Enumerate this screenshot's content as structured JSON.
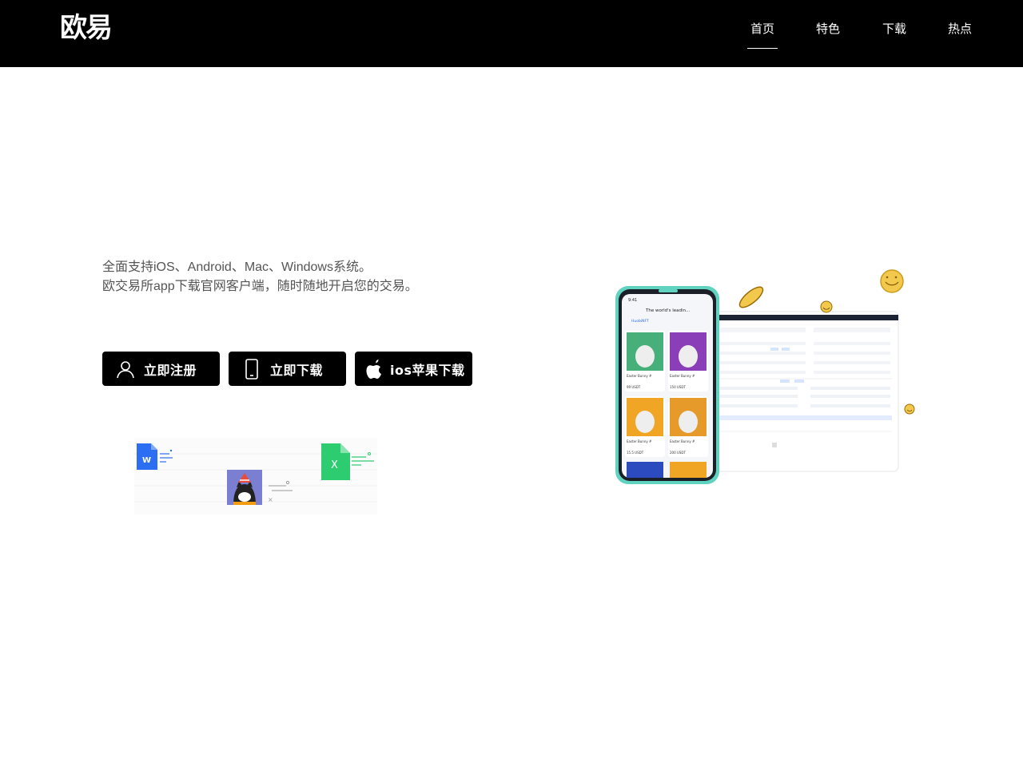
{
  "header": {
    "logo": "欧易",
    "nav": [
      {
        "label": "首页",
        "active": true
      },
      {
        "label": "特色",
        "active": false
      },
      {
        "label": "下载",
        "active": false
      },
      {
        "label": "热点",
        "active": false
      }
    ]
  },
  "hero": {
    "line1": "全面支持iOS、Android、Mac、Windows系统。",
    "line2": "欧交易所app下载官网客户端，随时随地开启您的交易。"
  },
  "buttons": {
    "register": {
      "label": "立即注册",
      "icon": "user-icon"
    },
    "download": {
      "label": "立即下载",
      "icon": "phone-icon"
    },
    "ios": {
      "label": "ios苹果下载",
      "icon": "apple-icon"
    }
  },
  "illustration": {
    "word_letter": "W",
    "excel_letter": "X"
  },
  "device": {
    "phone_time": "9:41",
    "phone_title": "The world's leadin...",
    "nft_header": "HuobiNFT",
    "cards": [
      {
        "name": "Easter Bunny #",
        "price": "99 USDT"
      },
      {
        "name": "Easter Bunny #",
        "price": "150 USDT"
      },
      {
        "name": "Easter Bunny #",
        "price": "15.5 USDT"
      },
      {
        "name": "Easter Bunny #",
        "price": "200 USDT"
      }
    ]
  },
  "colors": {
    "header_bg": "#000000",
    "button_bg": "#000000",
    "text": "#555555",
    "teal": "#5fd3c0",
    "word_blue": "#2b6ef2",
    "excel_green": "#2ecc71"
  }
}
